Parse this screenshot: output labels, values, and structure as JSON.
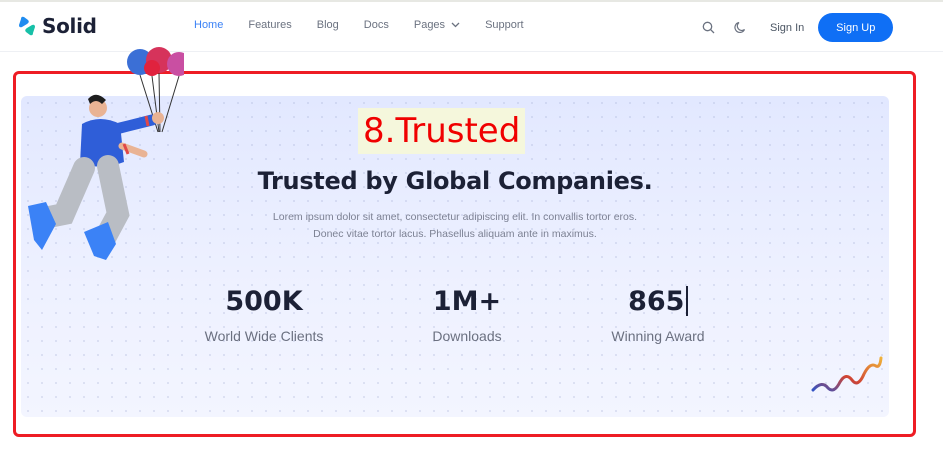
{
  "brand": {
    "name": "Solid",
    "accent": "#0f6ff5"
  },
  "nav": {
    "items": [
      {
        "label": "Home",
        "active": true
      },
      {
        "label": "Features",
        "active": false
      },
      {
        "label": "Blog",
        "active": false
      },
      {
        "label": "Docs",
        "active": false
      },
      {
        "label": "Pages",
        "active": false,
        "dropdown": true
      },
      {
        "label": "Support",
        "active": false
      }
    ],
    "icons": [
      "search-icon",
      "theme-moon-icon"
    ],
    "signin_label": "Sign In",
    "signup_label": "Sign Up"
  },
  "annotation": {
    "label": "8.Trusted",
    "color": "#ee1c24"
  },
  "section": {
    "title": "Trusted by Global Companies.",
    "description_line1": "Lorem ipsum dolor sit amet, consectetur adipiscing elit. In convallis tortor eros.",
    "description_line2": "Donec vitae tortor lacus. Phasellus aliquam ante in maximus.",
    "stats": [
      {
        "value": "500K",
        "label": "World Wide Clients"
      },
      {
        "value": "1M+",
        "label": "Downloads"
      },
      {
        "value": "865",
        "label": "Winning Award"
      }
    ]
  }
}
